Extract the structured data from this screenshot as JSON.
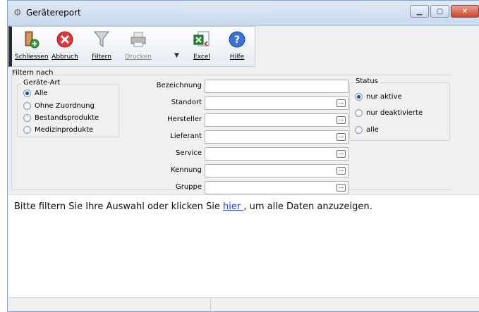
{
  "window": {
    "title": "Gerätereport"
  },
  "toolbar": {
    "buttons": [
      {
        "label": "Schliessen",
        "icon": "exit-door-icon"
      },
      {
        "label": "Abbruch",
        "icon": "cancel-icon"
      },
      {
        "label": "Filtern",
        "icon": "filter-icon"
      },
      {
        "label": "Drucken",
        "icon": "printer-icon"
      },
      {
        "label": "Excel",
        "icon": "excel-icon"
      },
      {
        "label": "Hilfe",
        "icon": "help-icon"
      }
    ]
  },
  "filter": {
    "section_title": "Filtern nach",
    "geraete_art": {
      "title": "Geräte-Art",
      "options": [
        "Alle",
        "Ohne Zuordnung",
        "Bestandsprodukte",
        "Medizinprodukte"
      ],
      "selected": "Alle"
    },
    "fields": [
      {
        "label": "Bezeichnung",
        "value": ""
      },
      {
        "label": "Standort",
        "value": ""
      },
      {
        "label": "Hersteller",
        "value": ""
      },
      {
        "label": "Lieferant",
        "value": ""
      },
      {
        "label": "Service",
        "value": ""
      },
      {
        "label": "Kennung",
        "value": ""
      },
      {
        "label": "Gruppe",
        "value": ""
      }
    ],
    "status": {
      "title": "Status",
      "options": [
        "nur aktive",
        "nur deaktivierte",
        "alle"
      ],
      "selected": "nur aktive"
    }
  },
  "message": {
    "before": "Bitte filtern Sie Ihre Auswahl oder klicken Sie ",
    "link": " hier ",
    "after": ", um alle Daten anzuzeigen."
  },
  "colors": {
    "link": "#2042d9",
    "accent": "#1f4f8f"
  }
}
